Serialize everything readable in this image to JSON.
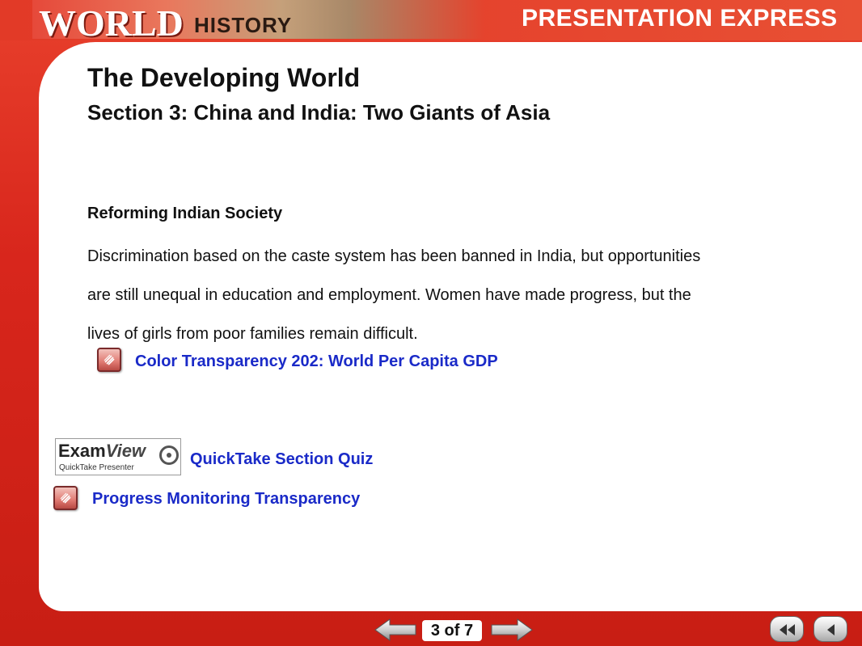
{
  "header": {
    "logo_world": "WORLD",
    "logo_history": "HISTORY",
    "title": "PRESENTATION EXPRESS"
  },
  "slide": {
    "title": "The Developing World",
    "subtitle": "Section 3: China and India: Two Giants of Asia",
    "heading": "Reforming Indian Society",
    "body_lines": [
      "Discrimination based on the caste system has been banned in India, but opportunities",
      "are still unequal in education and employment. Women have made progress, but the",
      "lives of girls from poor families remain difficult."
    ]
  },
  "links": {
    "color_transparency": "Color Transparency 202: World Per Capita GDP",
    "quicktake_quiz": "QuickTake Section Quiz",
    "progress_monitoring": "Progress Monitoring Transparency"
  },
  "examview": {
    "brand_exam": "Exam",
    "brand_view": "View",
    "subtitle": "QuickTake Presenter"
  },
  "footer": {
    "page_indicator": "3 of 7"
  },
  "icons": {
    "transparency": "transparency-icon",
    "prev": "arrow-left-icon",
    "next": "arrow-right-icon",
    "first": "rewind-icon",
    "back": "back-icon"
  },
  "colors": {
    "frame_red": "#d8261c",
    "link_blue": "#1a2ac8"
  }
}
